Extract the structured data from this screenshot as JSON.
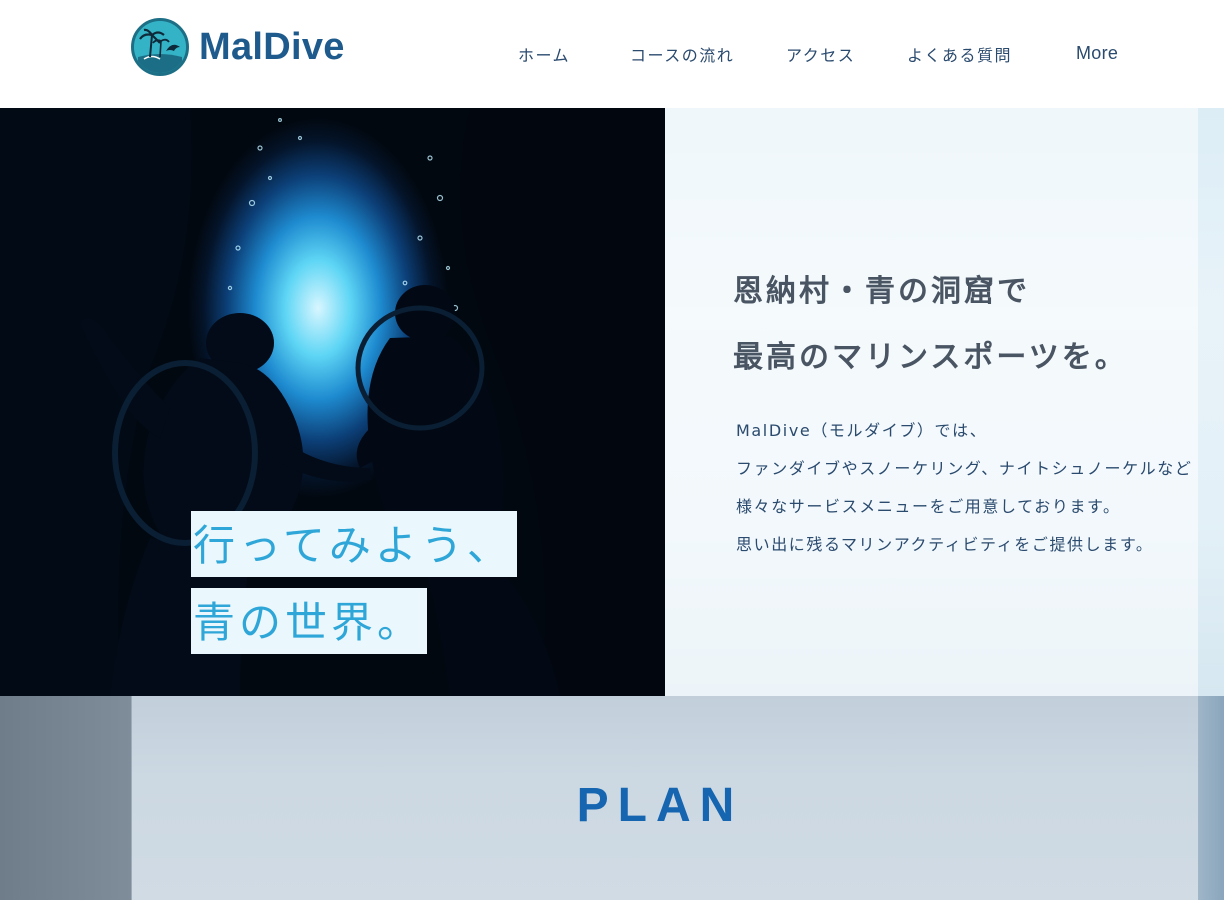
{
  "site": {
    "logo_text": "MalDive",
    "accent": "#1e5a8c",
    "link_color": "#2a4a6e",
    "tagline_color": "#2fa6d8",
    "plan_color": "#1565b0"
  },
  "nav": {
    "items": [
      {
        "label": "ホーム"
      },
      {
        "label": "コースの流れ"
      },
      {
        "label": "アクセス"
      },
      {
        "label": "よくある質問"
      },
      {
        "label": "More"
      }
    ]
  },
  "hero": {
    "tagline_line1": "行ってみよう、",
    "tagline_line2": "青の世界。"
  },
  "intro": {
    "headline_line1": "恩納村・青の洞窟で",
    "headline_line2": "最高のマリンスポーツを。",
    "desc_lines": [
      "MalDive（モルダイブ）では、",
      "ファンダイブやスノーケリング、ナイトシュノーケルなど",
      "様々なサービスメニューをご用意しております。",
      "思い出に残るマリンアクティビティをご提供します。"
    ]
  },
  "plan": {
    "title": "PLAN"
  },
  "icons": {
    "logo": "palm-island-dolphin-icon"
  }
}
